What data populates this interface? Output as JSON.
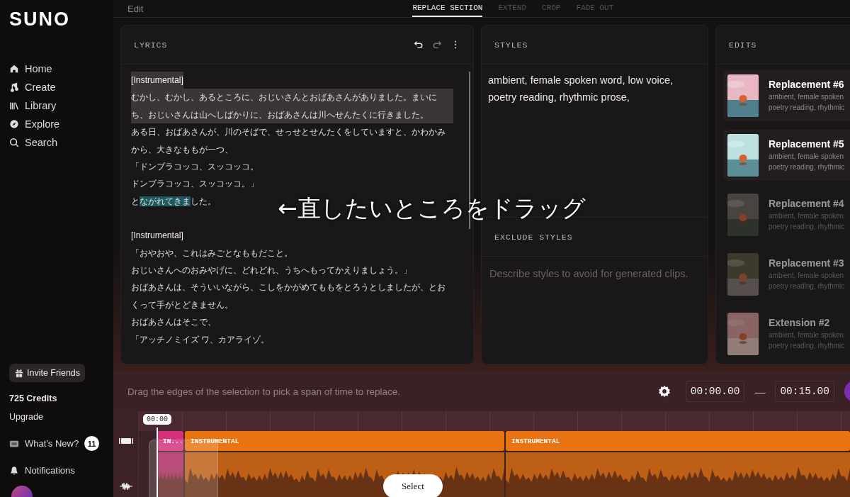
{
  "brand": "SUNO",
  "nav": [
    {
      "label": "Home"
    },
    {
      "label": "Create"
    },
    {
      "label": "Library"
    },
    {
      "label": "Explore"
    },
    {
      "label": "Search"
    }
  ],
  "invite": "Invite Friends",
  "credits": "725 Credits",
  "upgrade": "Upgrade",
  "whats_new": {
    "label": "What's New?",
    "badge": "11"
  },
  "notifications": "Notifications",
  "top": {
    "back": "Edit",
    "tabs": [
      {
        "label": "REPLACE SECTION",
        "selected": true
      },
      {
        "label": "EXTEND",
        "selected": false
      },
      {
        "label": "CROP",
        "selected": false
      },
      {
        "label": "FADE OUT",
        "selected": false
      }
    ]
  },
  "lyrics": {
    "title": "LYRICS",
    "redo_disabled": true,
    "lines": [
      {
        "kind": "tag",
        "shaded": true,
        "parts": [
          {
            "text": "[Instrumental]",
            "highlighted": false
          }
        ]
      },
      {
        "kind": "text",
        "shaded": true,
        "parts": [
          {
            "text": "むかし、むかし、あるところに、おじいさんとおばあさんがありました。まいにち、おじいさんは山へしばかりに、おばあさんは川へせんたくに行きました。",
            "highlighted": false
          }
        ]
      },
      {
        "kind": "text",
        "shaded": false,
        "parts": [
          {
            "text": " ある日、おばあさんが、川のそばで、せっせとせんたくをしていますと、かわかみから、大きなももが一つ、",
            "highlighted": false
          }
        ]
      },
      {
        "kind": "text",
        "shaded": false,
        "parts": [
          {
            "text": "「ドンブラコッコ、スッコッコ。",
            "highlighted": false
          }
        ]
      },
      {
        "kind": "text",
        "shaded": false,
        "parts": [
          {
            "text": "ドンブラコッコ、スッコッコ。」",
            "highlighted": false
          }
        ]
      },
      {
        "kind": "text",
        "shaded": false,
        "parts": [
          {
            "text": " と",
            "highlighted": false
          },
          {
            "text": "ながれてきま",
            "highlighted": true
          },
          {
            "text": "した。",
            "highlighted": false
          }
        ]
      },
      {
        "kind": "blank",
        "shaded": false
      },
      {
        "kind": "tag",
        "shaded": false,
        "parts": [
          {
            "text": "[Instrumental]",
            "highlighted": false
          }
        ]
      },
      {
        "kind": "text",
        "shaded": false,
        "parts": [
          {
            "text": "「おやおや、これはみごとなももだこと。",
            "highlighted": false
          }
        ]
      },
      {
        "kind": "text",
        "shaded": false,
        "parts": [
          {
            "text": "おじいさんへのおみやげに、どれどれ、うちへもってかえりましょう。」",
            "highlighted": false
          }
        ]
      },
      {
        "kind": "text",
        "shaded": false,
        "parts": [
          {
            "text": " おばあさんは、そういいながら、こしをかがめてももをとろうとしましたが、とおくって手がとどきません。",
            "highlighted": false
          }
        ]
      },
      {
        "kind": "text",
        "shaded": false,
        "parts": [
          {
            "text": "おばあさんはそこで、",
            "highlighted": false
          }
        ]
      },
      {
        "kind": "text",
        "shaded": false,
        "parts": [
          {
            "text": "「アッチノミイズ ワ、カアライゾ。",
            "highlighted": false
          }
        ]
      }
    ]
  },
  "styles": {
    "title": "STYLES",
    "value": "ambient, female spoken word, low voice, poetry reading, rhythmic prose,",
    "exclude_title": "EXCLUDE STYLES",
    "exclude_placeholder": "Describe styles to avoid for generated clips."
  },
  "annotation": "←直したいところをドラッグ",
  "edits": {
    "title": "EDITS",
    "items": [
      {
        "title": "Replacement #6",
        "line1": "ambient, female spoken",
        "line2": "poetry reading, rhythmic",
        "dimmed": false,
        "kind": "picture"
      },
      {
        "title": "Replacement #5",
        "line1": "ambient, female spoken",
        "line2": "poetry reading, rhythmic",
        "dimmed": false,
        "kind": "picture"
      },
      {
        "title": "Replacement #4",
        "line1": "ambient, female spoken",
        "line2": "poetry reading, rhythmic",
        "dimmed": true,
        "kind": "picture"
      },
      {
        "title": "Replacement #3",
        "line1": "ambient, female spoken",
        "line2": "poetry reading, rhythmic",
        "dimmed": true,
        "kind": "picture"
      },
      {
        "title": "Extension #2",
        "line1": "ambient, female spoken",
        "line2": "poetry reading, rhythmic",
        "dimmed": true,
        "kind": "picture"
      }
    ]
  },
  "timeline": {
    "hint": "Drag the edges of the selection to pick a span of time to replace.",
    "start": "00:00.00",
    "dash": "—",
    "end": "00:15.00",
    "playhead": "00:00",
    "segments": [
      {
        "label": "IN...",
        "color": "#d6307a"
      },
      {
        "label": "INSTRUMENTAL",
        "color": "#ea7411"
      },
      {
        "label": "INSTRUMENTAL",
        "color": "#ea7411"
      }
    ],
    "select": "Select"
  }
}
